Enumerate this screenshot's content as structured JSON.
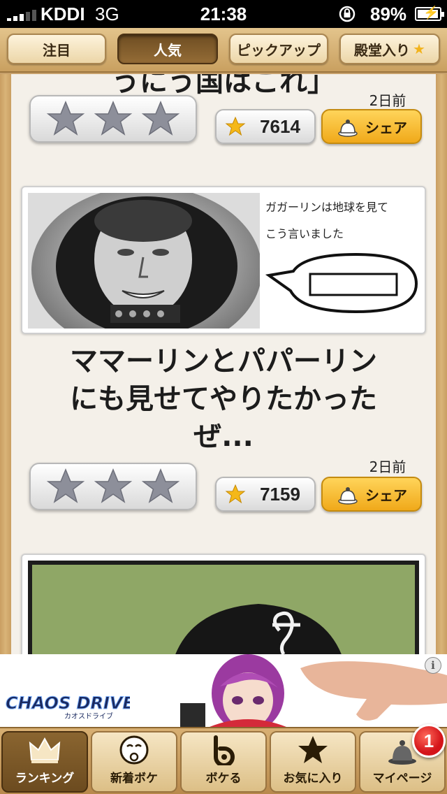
{
  "status_bar": {
    "carrier": "KDDI",
    "network": "3G",
    "time": "21:38",
    "battery_percent": "89%"
  },
  "top_tabs": [
    {
      "label": "注目",
      "active": false
    },
    {
      "label": "人気",
      "active": true
    },
    {
      "label": "ピックアップ",
      "active": false
    },
    {
      "label": "殿堂入り",
      "active": false,
      "icon": "star-icon"
    }
  ],
  "feed": {
    "prev_title_fragment": "うにう国はこれ」",
    "posts": [
      {
        "time_ago": "2日前",
        "rating_count": "7614",
        "share_label": "シェア"
      },
      {
        "image_caption_line1": "ガガーリンは地球を見て",
        "image_caption_line2": "こう言いました",
        "title_line1": "ママーリンとパパーリン",
        "title_line2": "にも見せてやりたかった",
        "title_line3": "ぜ...",
        "time_ago": "2日前",
        "rating_count": "7159",
        "share_label": "シェア"
      }
    ]
  },
  "ad": {
    "brand": "CHAOS DRIVE",
    "brand_sub": "カオスドライブ",
    "info_label": "i"
  },
  "bottom_tabs": [
    {
      "label": "ランキング",
      "icon": "crown-icon",
      "active": true
    },
    {
      "label": "新着ボケ",
      "icon": "funny-face-icon",
      "active": false
    },
    {
      "label": "ボケる",
      "icon": "bokete-logo-icon",
      "active": false
    },
    {
      "label": "お気に入り",
      "icon": "star-icon",
      "active": false
    },
    {
      "label": "マイページ",
      "icon": "bell-icon",
      "active": false,
      "badge": "1"
    }
  ],
  "colors": {
    "wood": "#c7a06a",
    "paper": "#f4f0e9",
    "share_gold": "#f0a91a",
    "badge_red": "#d4141a"
  }
}
